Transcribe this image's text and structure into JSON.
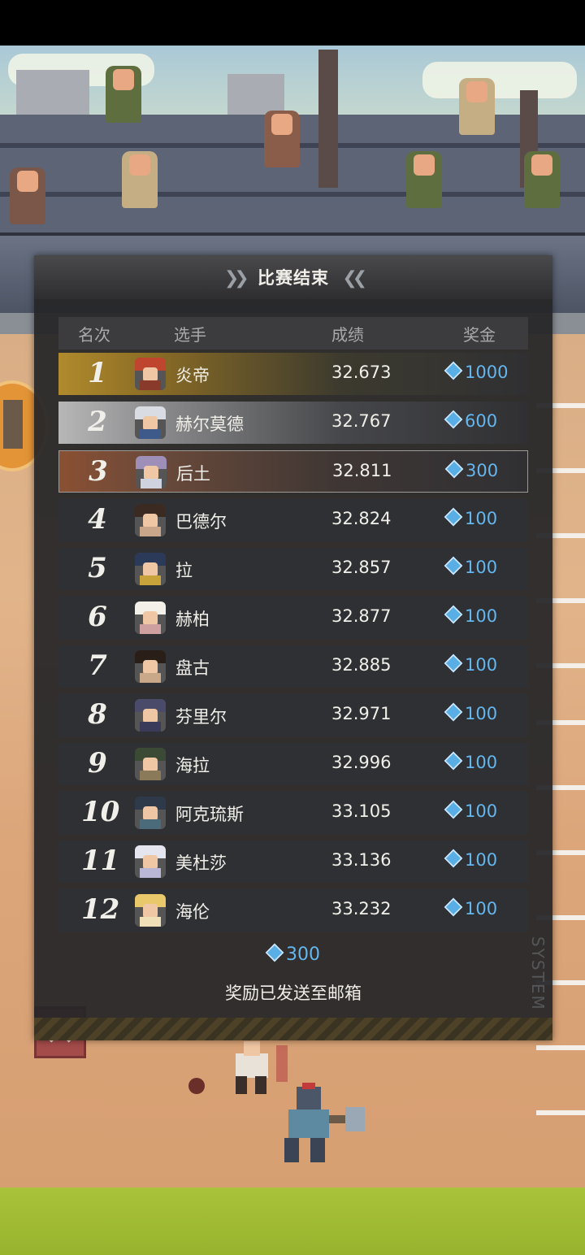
{
  "panel": {
    "title": "比赛结束",
    "headers": {
      "rank": "名次",
      "player": "选手",
      "score": "成绩",
      "prize": "奖金"
    },
    "rows": [
      {
        "rank": "1",
        "name": "炎帝",
        "score": "32.673",
        "prize": "1000"
      },
      {
        "rank": "2",
        "name": "赫尔莫德",
        "score": "32.767",
        "prize": "600"
      },
      {
        "rank": "3",
        "name": "后土",
        "score": "32.811",
        "prize": "300"
      },
      {
        "rank": "4",
        "name": "巴德尔",
        "score": "32.824",
        "prize": "100"
      },
      {
        "rank": "5",
        "name": "拉",
        "score": "32.857",
        "prize": "100"
      },
      {
        "rank": "6",
        "name": "赫柏",
        "score": "32.877",
        "prize": "100"
      },
      {
        "rank": "7",
        "name": "盘古",
        "score": "32.885",
        "prize": "100"
      },
      {
        "rank": "8",
        "name": "芬里尔",
        "score": "32.971",
        "prize": "100"
      },
      {
        "rank": "9",
        "name": "海拉",
        "score": "32.996",
        "prize": "100"
      },
      {
        "rank": "10",
        "name": "阿克琉斯",
        "score": "33.105",
        "prize": "100"
      },
      {
        "rank": "11",
        "name": "美杜莎",
        "score": "33.136",
        "prize": "100"
      },
      {
        "rank": "12",
        "name": "海伦",
        "score": "33.232",
        "prize": "100"
      }
    ],
    "total_reward": "300",
    "mail_notice": "奖励已发送至邮箱",
    "side_label": "SYSTEM"
  },
  "close_button": "✕",
  "colors": {
    "prize_text": "#64b6ee",
    "panel_bg": "#262628",
    "gold": "#b08a2c",
    "silver": "#b7b7b7",
    "bronze": "#8a5033"
  },
  "icons": {
    "currency": "diamond-gem-icon",
    "close": "close-icon"
  }
}
